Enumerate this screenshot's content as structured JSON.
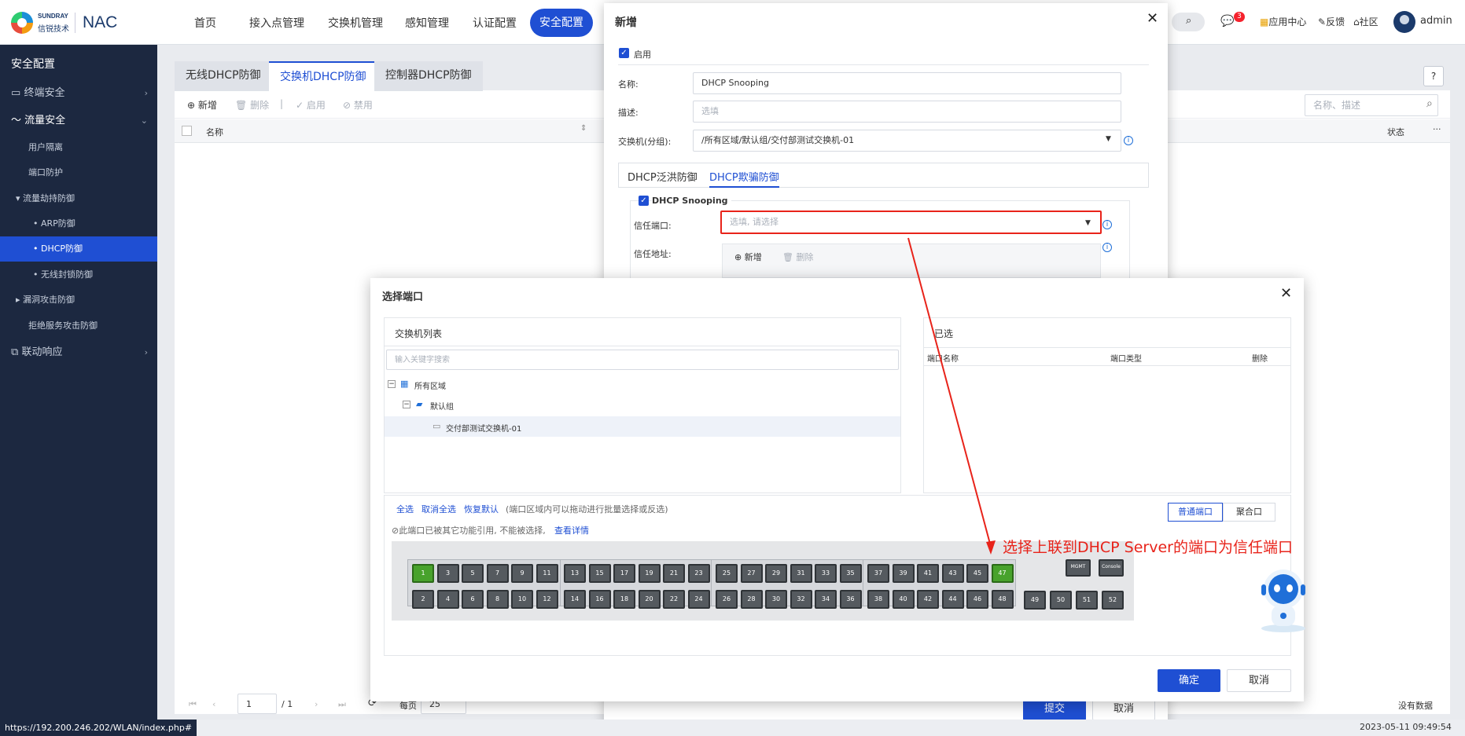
{
  "header": {
    "brand_line1": "SUNDRAY",
    "brand_line2": "信锐技术",
    "product": "NAC",
    "nav": [
      "首页",
      "接入点管理",
      "交换机管理",
      "感知管理",
      "认证配置",
      "安全配置"
    ],
    "nav_active": "安全配置",
    "messages_count": "3",
    "app_center": "应用中心",
    "feedback": "反馈",
    "community": "社区",
    "user": "admin"
  },
  "sidebar": {
    "title": "安全配置",
    "items": [
      {
        "label": "终端安全"
      },
      {
        "label": "流量安全"
      },
      {
        "label": "用户隔离"
      },
      {
        "label": "端口防护"
      },
      {
        "label": "流量劫持防御"
      },
      {
        "label": "ARP防御"
      },
      {
        "label": "DHCP防御"
      },
      {
        "label": "无线封锁防御"
      },
      {
        "label": "漏洞攻击防御"
      },
      {
        "label": "拒绝服务攻击防御"
      },
      {
        "label": "联动响应"
      }
    ]
  },
  "main": {
    "tabs": [
      "无线DHCP防御",
      "交换机DHCP防御",
      "控制器DHCP防御"
    ],
    "active_tab": "交换机DHCP防御",
    "toolbar": {
      "add": "新增",
      "delete": "删除",
      "enable": "启用",
      "disable": "禁用"
    },
    "search_placeholder": "名称、描述",
    "columns": [
      "名称",
      "状态"
    ],
    "pager": {
      "page": "1",
      "total": "/ 1",
      "per_page_label": "每页",
      "per_page": "25",
      "empty": "没有数据"
    }
  },
  "dialog_add": {
    "title": "新增",
    "enable_label": "启用",
    "name_label": "名称:",
    "name_value": "DHCP Snooping",
    "desc_label": "描述:",
    "desc_placeholder": "选填",
    "switch_label": "交换机(分组):",
    "switch_value": "/所有区域/默认组/交付部测试交换机-01",
    "tabs": [
      "DHCP泛洪防御",
      "DHCP欺骗防御"
    ],
    "active_tab": "DHCP欺骗防御",
    "snooping_label": "DHCP Snooping",
    "trust_port_label": "信任端口:",
    "trust_port_placeholder": "选填, 请选择",
    "trust_addr_label": "信任地址:",
    "add": "新增",
    "delete": "删除",
    "submit": "提交",
    "cancel": "取消"
  },
  "dialog_ports": {
    "title": "选择端口",
    "switch_list_title": "交换机列表",
    "search_placeholder": "输入关键字搜索",
    "tree": [
      "所有区域",
      "默认组",
      "交付部测试交换机-01"
    ],
    "selected_title": "已选",
    "selected_columns": [
      "端口名称",
      "端口类型",
      "删除"
    ],
    "select_all": "全选",
    "deselect_all": "取消全选",
    "restore": "恢复默认",
    "drag_hint": "(端口区域内可以拖动进行批量选择或反选)",
    "used_hint": "⊘此端口已被其它功能引用, 不能被选择,",
    "view_detail": "查看详情",
    "mode_normal": "普通端口",
    "mode_agg": "聚合口",
    "top_ports": [
      "1",
      "3",
      "5",
      "7",
      "9",
      "11",
      "13",
      "15",
      "17",
      "19",
      "21",
      "23",
      "25",
      "27",
      "29",
      "31",
      "33",
      "35",
      "37",
      "39",
      "41",
      "43",
      "45",
      "47"
    ],
    "bottom_ports": [
      "2",
      "4",
      "6",
      "8",
      "10",
      "12",
      "14",
      "16",
      "18",
      "20",
      "22",
      "24",
      "26",
      "28",
      "30",
      "32",
      "34",
      "36",
      "38",
      "40",
      "42",
      "44",
      "46",
      "48"
    ],
    "selected_ports": [
      "1",
      "47"
    ],
    "sfp_ports": [
      "49",
      "50",
      "51",
      "52"
    ],
    "mgmt": "MGMT",
    "console": "Console",
    "ok": "确定",
    "cancel": "取消"
  },
  "annotation": "选择上联到DHCP Server的端口为信任端口",
  "status": {
    "url": "https://192.200.246.202/WLAN/index.php#",
    "datetime": "2023-05-11 09:49:54"
  },
  "colors": {
    "primary": "#1f4fd3",
    "sidebar": "#1c2840",
    "annotation": "#e8231a",
    "port_selected": "#48a22c"
  }
}
